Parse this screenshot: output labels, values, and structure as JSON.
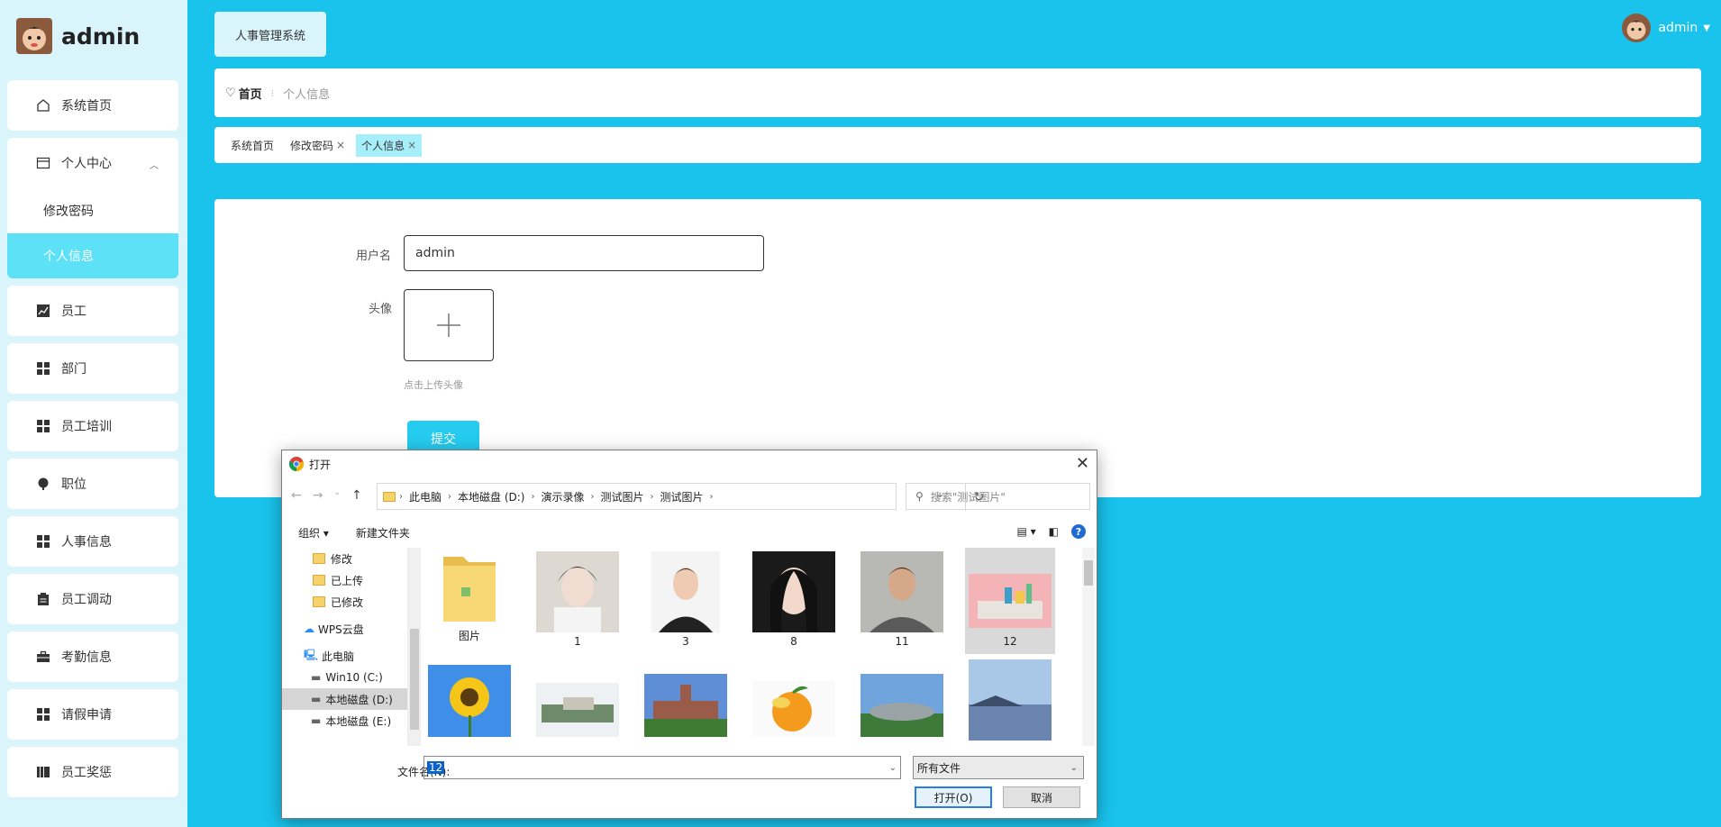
{
  "sidebar": {
    "brand_title": "admin",
    "items": [
      {
        "label": "系统首页",
        "icon": "home-icon"
      },
      {
        "label": "个人中心",
        "icon": "panel-icon",
        "expanded": true,
        "children": [
          "修改密码",
          "个人信息"
        ],
        "active_child": "个人信息"
      },
      {
        "label": "员工",
        "icon": "chart-icon"
      },
      {
        "label": "部门",
        "icon": "grid-icon"
      },
      {
        "label": "员工培训",
        "icon": "grid-icon"
      },
      {
        "label": "职位",
        "icon": "palette-icon"
      },
      {
        "label": "人事信息",
        "icon": "grid-icon"
      },
      {
        "label": "员工调动",
        "icon": "clipboard-icon"
      },
      {
        "label": "考勤信息",
        "icon": "briefcase-icon"
      },
      {
        "label": "请假申请",
        "icon": "grid-icon"
      },
      {
        "label": "员工奖惩",
        "icon": "book-icon"
      }
    ]
  },
  "header": {
    "app_title": "人事管理系统",
    "user_name": "admin"
  },
  "breadcrumb": {
    "home": "首页",
    "current": "个人信息"
  },
  "tabs": [
    {
      "label": "系统首页",
      "closable": false,
      "active": false
    },
    {
      "label": "修改密码",
      "closable": true,
      "active": false
    },
    {
      "label": "个人信息",
      "closable": true,
      "active": true
    }
  ],
  "form": {
    "username_label": "用户名",
    "username_value": "admin",
    "avatar_label": "头像",
    "upload_hint": "点击上传头像",
    "submit_label": "提交"
  },
  "dialog": {
    "title": "打开",
    "path": [
      "此电脑",
      "本地磁盘 (D:)",
      "演示录像",
      "测试图片",
      "测试图片"
    ],
    "search_placeholder": "搜索\"测试图片\"",
    "toolbar_organize": "组织 ▾",
    "toolbar_new_folder": "新建文件夹",
    "tree": [
      "修改",
      "已上传",
      "已修改",
      "WPS云盘",
      "此电脑",
      "Win10 (C:)",
      "本地磁盘 (D:)",
      "本地磁盘 (E:)"
    ],
    "tree_selected": "本地磁盘 (D:)",
    "files_row1": [
      "图片",
      "1",
      "3",
      "8",
      "11",
      "12"
    ],
    "selected_file": "12",
    "filename_label": "文件名(N):",
    "filename_value": "12",
    "filetype_value": "所有文件",
    "open_label": "打开(O)",
    "cancel_label": "取消"
  },
  "colors": {
    "background": "#19c3ec",
    "sidebar": "#d9f4fb",
    "active_item": "#5ce1f7",
    "submit": "#25ccef"
  }
}
